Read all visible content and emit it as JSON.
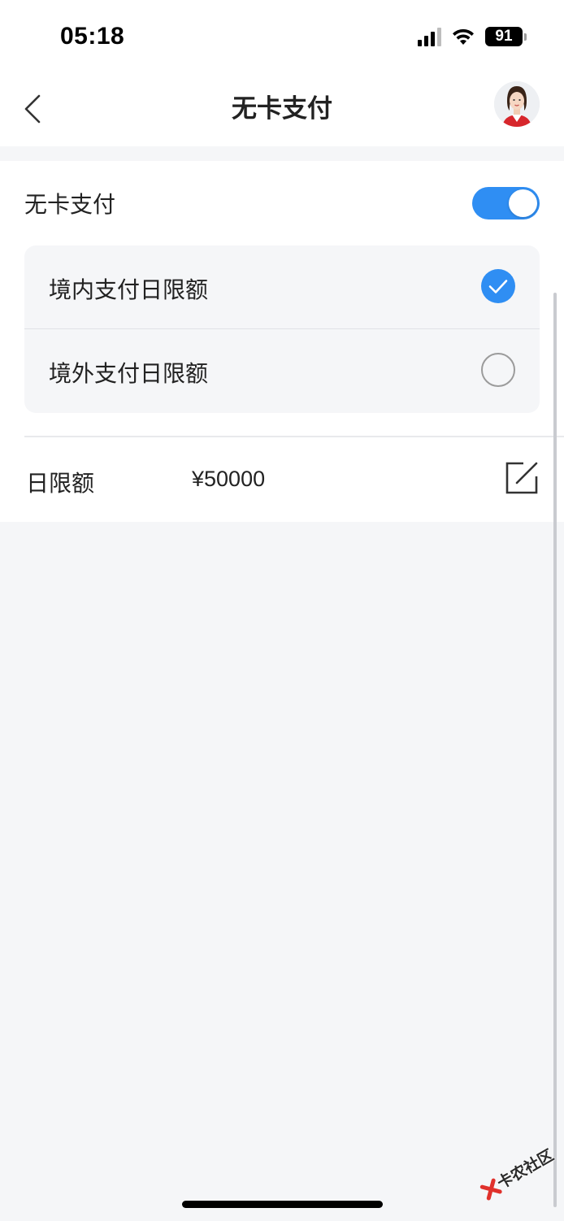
{
  "status_bar": {
    "time": "05:18",
    "battery": "91",
    "icons": [
      "cellular-signal-icon",
      "wifi-icon",
      "battery-icon"
    ]
  },
  "nav": {
    "title": "无卡支付",
    "back_icon": "chevron-left-icon",
    "avatar_icon": "customer-service-avatar"
  },
  "card": {
    "toggle": {
      "label": "无卡支付",
      "on": true
    },
    "options": [
      {
        "label": "境内支付日限额",
        "checked": true
      },
      {
        "label": "境外支付日限额",
        "checked": false
      }
    ],
    "limit": {
      "label": "日限额",
      "value": "¥50000",
      "edit_icon": "edit-icon"
    }
  },
  "watermark": {
    "text": "卡农社区"
  },
  "colors": {
    "accent": "#2f8ef3",
    "background": "#f5f6f8",
    "card": "#ffffff"
  }
}
